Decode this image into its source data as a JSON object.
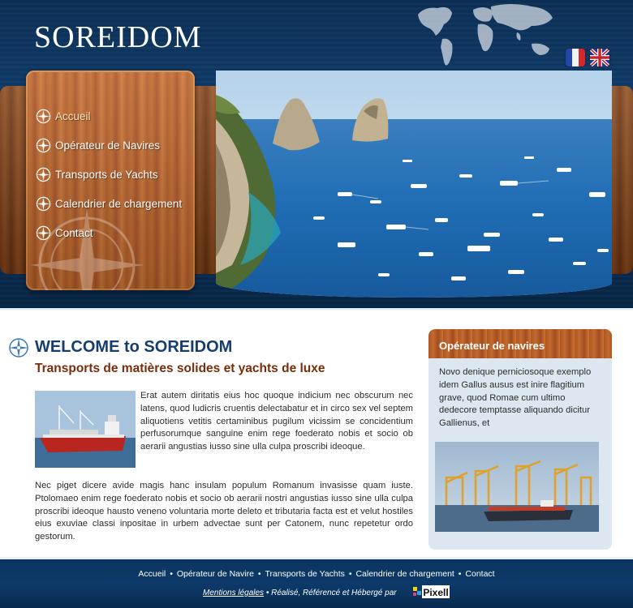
{
  "header": {
    "logo": "SOREIDOM",
    "languages": [
      {
        "code": "fr",
        "icon": "flag-france-icon"
      },
      {
        "code": "en",
        "icon": "flag-uk-icon"
      }
    ]
  },
  "nav": {
    "items": [
      {
        "label": "Accueil",
        "active": true
      },
      {
        "label": "Opérateur de Navires"
      },
      {
        "label": "Transports de Yachts"
      },
      {
        "label": "Calendrier de chargement"
      },
      {
        "label": "Contact"
      }
    ]
  },
  "main": {
    "title": "WELCOME to SOREIDOM",
    "subtitle": "Transports de matières solides et yachts de luxe",
    "paragraph1": "Erat autem diritatis eius hoc quoque indicium nec obscurum nec latens, quod ludicris cruentis delectabatur et in circo sex vel septem aliquotiens vetitis certaminibus pugilum vicissim se concidentium perfusorumque sanguine enim rege foederato nobis et socio ob aerarii angustias iusso sine ulla culpa proscribi ideoque.",
    "paragraph2": "Nec piget dicere avide magis hanc insulam populum Romanum invasisse quam iuste. Ptolomaeo enim rege foederato nobis et socio ob aerarii nostri angustias iusso sine ulla culpa proscribi ideoque hausto veneno voluntaria morte deleto et tributaria facta est et velut hostiles eius exuviae classi inpositae in urbem advectae sunt per Catonem, nunc repetetur ordo gestorum."
  },
  "sidebar": {
    "title": "Opérateur de navires",
    "text": "Novo denique perniciosoque exemplo idem Gallus ausus est inire flagitium grave, quod Romae cum ultimo dedecore temptasse aliquando dicitur Gallienus, et"
  },
  "footer": {
    "links": [
      "Accueil",
      "Opérateur de Navire",
      "Transports de Yachts",
      "Calendrier de chargement",
      "Contact"
    ],
    "separator": "•",
    "legal": "Mentions légales",
    "credit": " • Réalisé, Référencé et Hébergé par",
    "brand": "Pixell"
  }
}
